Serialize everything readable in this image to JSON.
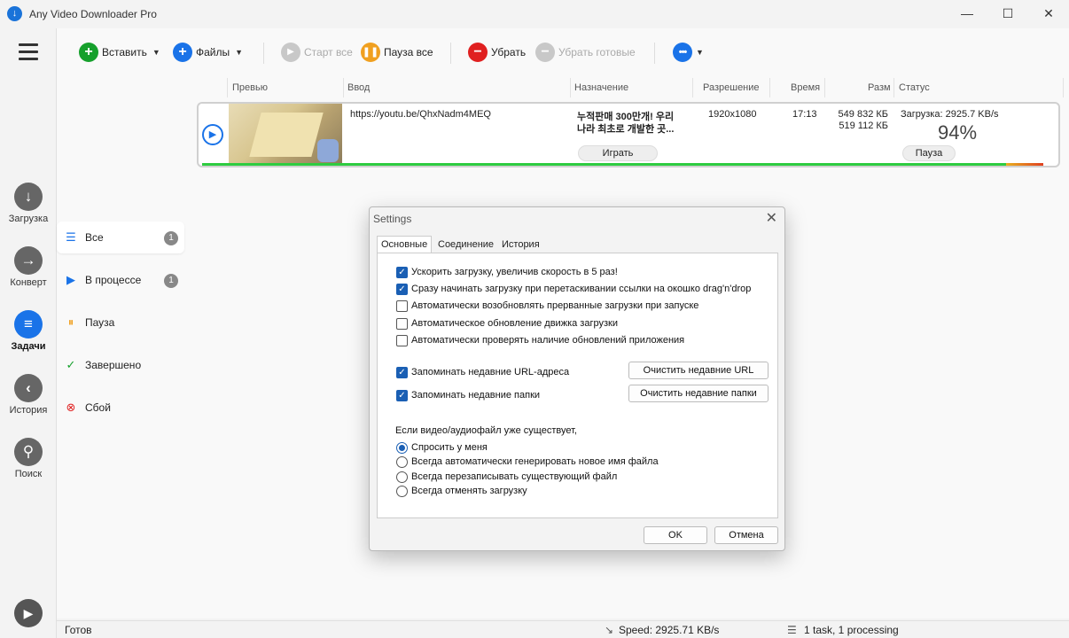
{
  "window": {
    "title": "Any Video Downloader Pro",
    "minimize_icon": "minimize-icon",
    "maximize_icon": "maximize-icon",
    "close_icon": "close-icon"
  },
  "sidebar": {
    "items": [
      {
        "label": "Загрузка",
        "icon": "download-icon",
        "glyph": "↓",
        "active": false
      },
      {
        "label": "Конверт",
        "icon": "convert-icon",
        "glyph": "→",
        "active": false
      },
      {
        "label": "Задачи",
        "icon": "tasks-icon",
        "glyph": "≡",
        "active": true
      },
      {
        "label": "История",
        "icon": "history-icon",
        "glyph": "‹",
        "active": false
      },
      {
        "label": "Поиск",
        "icon": "search-icon",
        "glyph": "⚲",
        "active": false
      }
    ]
  },
  "toolbar": {
    "paste_label": "Вставить",
    "files_label": "Файлы",
    "start_all_label": "Старт все",
    "pause_all_label": "Пауза все",
    "remove_label": "Убрать",
    "remove_done_label": "Убрать готовые"
  },
  "filters": [
    {
      "label": "Все",
      "count": "1",
      "active": true
    },
    {
      "label": "В процессе",
      "count": "1",
      "active": false
    },
    {
      "label": "Пауза",
      "count": "",
      "active": false
    },
    {
      "label": "Завершено",
      "count": "",
      "active": false
    },
    {
      "label": "Сбой",
      "count": "",
      "active": false
    }
  ],
  "columns": {
    "preview": "Превью",
    "input": "Ввод",
    "destination": "Назначение",
    "resolution": "Разрешение",
    "time": "Время",
    "size": "Разм",
    "status": "Статус"
  },
  "download": {
    "url": "https://youtu.be/QhxNadm4MEQ",
    "title_line1": "누적판매 300만개! 우리",
    "title_line2": "나라 최초로 개발한 곳...",
    "resolution": "1920x1080",
    "duration": "17:13",
    "size_total": "549 832 КБ",
    "size_done": "519 112 КБ",
    "status_text": "Загрузка: 2925.7 KB/s",
    "percent": "94%",
    "progress_fraction": 0.94,
    "play_label": "Играть",
    "pause_label": "Пауза"
  },
  "statusbar": {
    "ready": "Готов",
    "speed": "Speed: 2925.71 KB/s",
    "tasks": "1 task, 1 processing"
  },
  "settings": {
    "title": "Settings",
    "tabs": [
      "Основные",
      "Соединение",
      "История"
    ],
    "checkboxes": [
      {
        "label": "Ускорить загрузку, увеличив скорость в 5 раз!",
        "checked": true
      },
      {
        "label": "Сразу начинать загрузку при перетаскивании ссылки на окошко drag'n'drop",
        "checked": true
      },
      {
        "label": "Автоматически возобновлять прерванные загрузки при запуске",
        "checked": false
      },
      {
        "label": "Автоматическое обновление движка загрузки",
        "checked": false
      },
      {
        "label": "Автоматически проверять наличие обновлений приложения",
        "checked": false
      }
    ],
    "remember_urls": {
      "label": "Запоминать недавние URL-адреса",
      "checked": true,
      "button": "Очистить недавние URL"
    },
    "remember_folders": {
      "label": "Запоминать недавние папки",
      "checked": true,
      "button": "Очистить недавние папки"
    },
    "exists_question": "Если видео/аудиофайл уже существует,",
    "radios": [
      {
        "label": "Спросить у меня",
        "selected": true
      },
      {
        "label": "Всегда автоматически генерировать новое имя файла",
        "selected": false
      },
      {
        "label": "Всегда перезаписывать существующий файл",
        "selected": false
      },
      {
        "label": "Всегда отменять загрузку",
        "selected": false
      }
    ],
    "ok_label": "OK",
    "cancel_label": "Отмена"
  }
}
